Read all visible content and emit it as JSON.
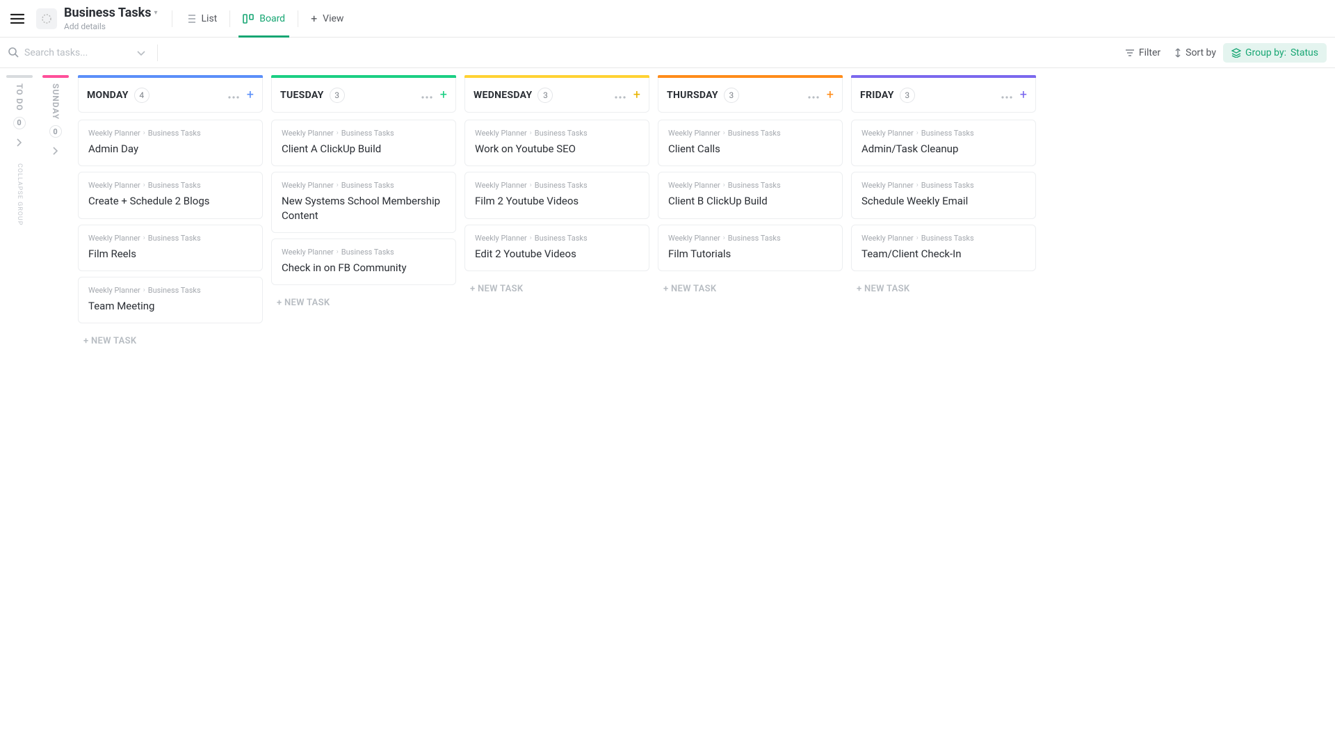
{
  "header": {
    "title": "Business Tasks",
    "subtitle": "Add details",
    "views": {
      "list": "List",
      "board": "Board",
      "add": "View"
    }
  },
  "toolbar": {
    "search_placeholder": "Search tasks...",
    "filter": "Filter",
    "sort": "Sort by",
    "groupby_prefix": "Group by:",
    "groupby_value": "Status"
  },
  "collapsed": {
    "todo": {
      "label": "TO DO",
      "count": "0"
    },
    "sunday": {
      "label": "SUNDAY",
      "count": "0"
    },
    "collapse": "COLLAPSE GROUP"
  },
  "breadcrumb": {
    "parent": "Weekly Planner",
    "child": "Business Tasks"
  },
  "newtask": "+ NEW TASK",
  "columns": [
    {
      "title": "MONDAY",
      "count": "4",
      "bar": "c-blue",
      "plus": "t-blue",
      "cards": [
        "Admin Day",
        "Create + Schedule 2 Blogs",
        "Film Reels",
        "Team Meeting"
      ]
    },
    {
      "title": "TUESDAY",
      "count": "3",
      "bar": "c-green",
      "plus": "t-green",
      "cards": [
        "Client A ClickUp Build",
        "New Systems School Member­ship Content",
        "Check in on FB Community"
      ]
    },
    {
      "title": "WEDNESDAY",
      "count": "3",
      "bar": "c-yellow",
      "plus": "t-yellow",
      "cards": [
        "Work on Youtube SEO",
        "Film 2 Youtube Videos",
        "Edit 2 Youtube Videos"
      ]
    },
    {
      "title": "THURSDAY",
      "count": "3",
      "bar": "c-orange",
      "plus": "t-orange",
      "cards": [
        "Client Calls",
        "Client B ClickUp Build",
        "Film Tutorials"
      ]
    },
    {
      "title": "FRIDAY",
      "count": "3",
      "bar": "c-purple",
      "plus": "t-purple",
      "cards": [
        "Admin/Task Cleanup",
        "Schedule Weekly Email",
        "Team/Client Check-In"
      ]
    }
  ]
}
